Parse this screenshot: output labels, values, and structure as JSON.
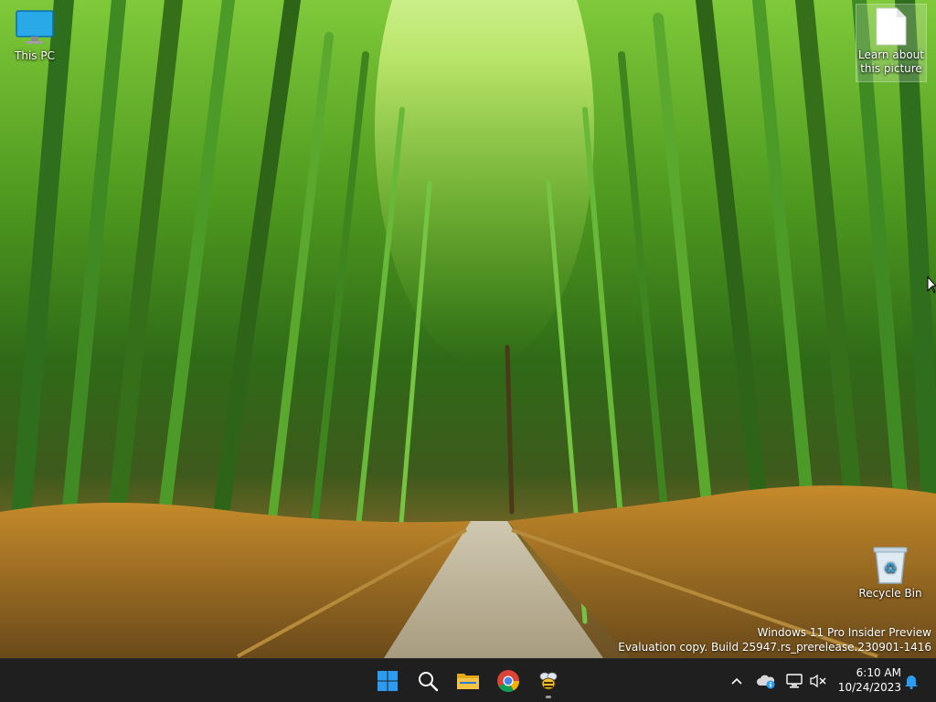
{
  "desktop": {
    "icons": [
      {
        "label": "This PC",
        "icon": "computer-monitor-icon"
      },
      {
        "label": "Learn about this picture",
        "icon": "document-icon"
      },
      {
        "label": "Recycle Bin",
        "icon": "recycle-bin-icon"
      }
    ],
    "watermark": {
      "line1": "Windows 11 Pro Insider Preview",
      "line2": "Evaluation copy. Build 25947.rs_prerelease.230901-1416"
    }
  },
  "taskbar": {
    "apps": [
      {
        "name": "Start",
        "icon": "windows-start-icon"
      },
      {
        "name": "Search",
        "icon": "search-icon"
      },
      {
        "name": "File Explorer",
        "icon": "folder-icon"
      },
      {
        "name": "Google Chrome",
        "icon": "chrome-icon"
      },
      {
        "name": "App",
        "icon": "bee-icon"
      }
    ],
    "clock": {
      "time": "6:10 AM",
      "date": "10/24/2023"
    }
  },
  "colors": {
    "taskbar_bg": "#1f1f1f",
    "accent_blue": "#1e90ff",
    "folder_yellow": "#f6c343",
    "foliage_green": "#5fb52a"
  }
}
